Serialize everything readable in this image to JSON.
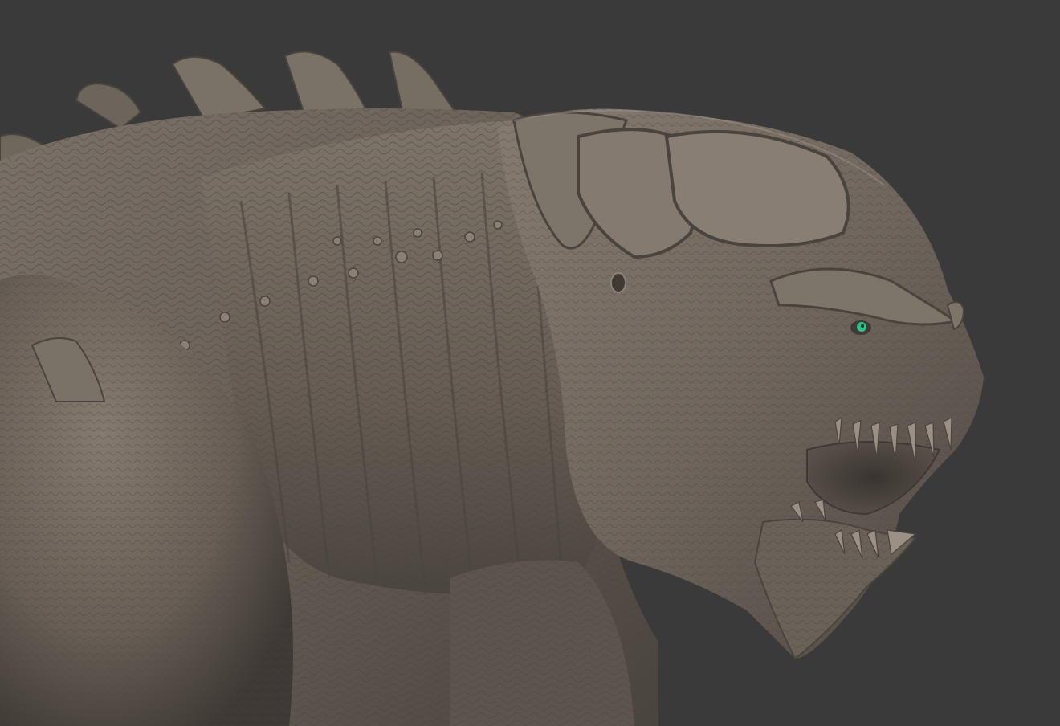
{
  "scene": {
    "background_color": "#3a3a3a",
    "skin_color": "#6f665e",
    "skin_shadow_color": "#3f3a35",
    "skin_highlight_color": "#948a80",
    "eye_color": "#2fbf8a",
    "subject_icon": "kaiju-sculpt-icon"
  }
}
